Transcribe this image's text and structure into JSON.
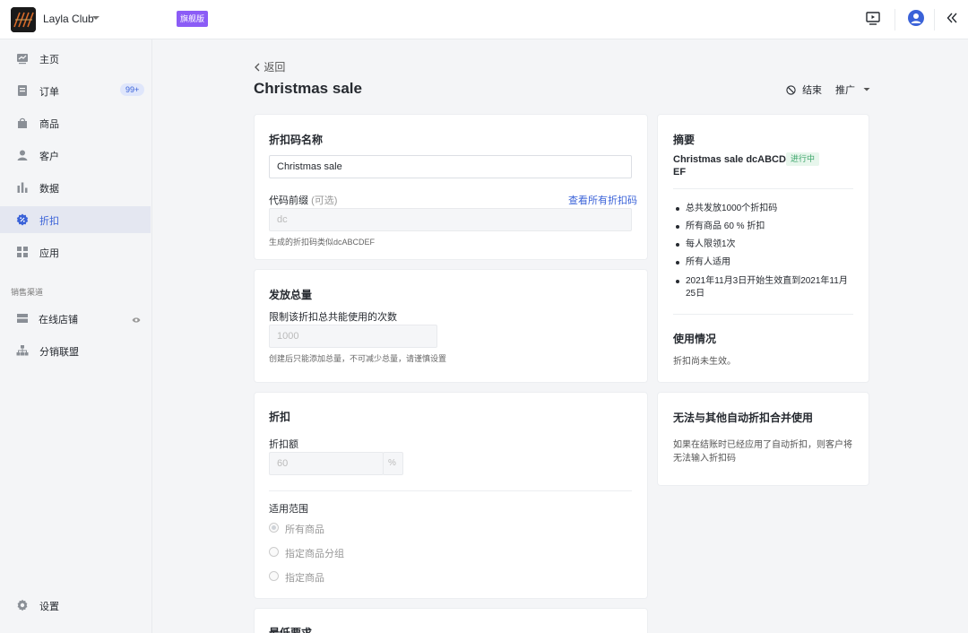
{
  "colors": {
    "accent": "#3a62d8",
    "plan_badge": "#8b5cf6",
    "status_active": "#3ca56a",
    "background": "#f4f5f7"
  },
  "topbar": {
    "store_name": "Layla Club",
    "plan_badge": "旗舰版",
    "icons": [
      "preview-screen-icon",
      "user-avatar-icon",
      "collapse-icon"
    ]
  },
  "sidebar": {
    "items": [
      {
        "label": "主页",
        "icon": "home-chart-icon"
      },
      {
        "label": "订单",
        "icon": "order-icon",
        "badge": "99+"
      },
      {
        "label": "商品",
        "icon": "product-bag-icon"
      },
      {
        "label": "客户",
        "icon": "customer-icon"
      },
      {
        "label": "数据",
        "icon": "data-bars-icon"
      },
      {
        "label": "折扣",
        "icon": "discount-icon",
        "active": true
      },
      {
        "label": "应用",
        "icon": "apps-grid-icon"
      }
    ],
    "section_label": "销售渠道",
    "channels": [
      {
        "label": "在线店铺",
        "icon": "storefront-icon",
        "extra_icon": "eye-icon"
      },
      {
        "label": "分销联盟",
        "icon": "affiliate-icon"
      }
    ],
    "settings_label": "设置"
  },
  "header": {
    "back_label": "返回",
    "title": "Christmas sale",
    "end_label": "结束",
    "promote_label": "推广"
  },
  "code_card": {
    "title": "折扣码名称",
    "name_value": "Christmas sale",
    "prefix_label": "代码前缀",
    "prefix_optional": "(可选)",
    "view_all_link": "查看所有折扣码",
    "prefix_placeholder": "dc",
    "prefix_hint": "生成的折扣码类似dcABCDEF"
  },
  "quantity_card": {
    "title": "发放总量",
    "label": "限制该折扣总共能使用的次数",
    "value": "1000",
    "hint": "创建后只能添加总量，不可减少总量，请谨慎设置"
  },
  "discount_card": {
    "title": "折扣",
    "amount_label": "折扣额",
    "amount_value": "60",
    "amount_suffix": "%",
    "scope_label": "适用范围",
    "scope_options": [
      "所有商品",
      "指定商品分组",
      "指定商品"
    ],
    "scope_selected": "所有商品"
  },
  "min_card": {
    "title": "最低要求"
  },
  "summary": {
    "heading": "摘要",
    "code_title": "Christmas sale dcABCD EF",
    "status": "进行中",
    "bullets": [
      "总共发放1000个折扣码",
      "所有商品 60 % 折扣",
      "每人限领1次",
      "所有人适用",
      "2021年11月3日开始生效直到2021年11月25日"
    ],
    "usage_heading": "使用情况",
    "usage_text": "折扣尚未生效。"
  },
  "combine": {
    "heading": "无法与其他自动折扣合并使用",
    "text": "如果在结账时已经应用了自动折扣，则客户将无法输入折扣码"
  }
}
